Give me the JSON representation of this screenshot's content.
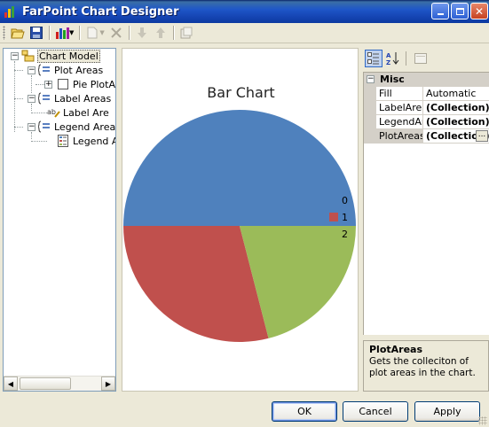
{
  "window": {
    "title": "FarPoint Chart Designer"
  },
  "toolbar": {
    "icons": [
      "open-folder-icon",
      "save-icon",
      "chart-type-icon",
      "new-document-icon",
      "delete-icon",
      "move-down-icon",
      "move-up-icon",
      "properties-icon"
    ]
  },
  "tree": {
    "root": "Chart Model",
    "plot_areas": "Plot Areas",
    "pie_plot_area": "Pie PlotAr",
    "label_areas": "Label Areas",
    "label_area": "Label Are",
    "legend_areas": "Legend Areas",
    "legend_area": "Legend A"
  },
  "chart_data": {
    "type": "pie",
    "title": "Bar Chart",
    "labels": [
      "0",
      "1",
      "2"
    ],
    "values": [
      50,
      29,
      21
    ],
    "colors": [
      "#4f81bd",
      "#c0504d",
      "#9bbb59"
    ],
    "legend_position": "right"
  },
  "property_grid": {
    "category": "Misc",
    "rows": [
      {
        "name": "Fill",
        "value": "Automatic",
        "bold": false
      },
      {
        "name": "LabelAreas",
        "value": "(Collection)",
        "bold": true
      },
      {
        "name": "LegendAreas",
        "value": "(Collection)",
        "bold": true
      },
      {
        "name": "PlotAreas",
        "value": "(Collection)",
        "bold": true
      }
    ],
    "ellipsis": "..."
  },
  "help": {
    "title": "PlotAreas",
    "description": "Gets the colleciton of plot areas in the chart."
  },
  "buttons": {
    "ok": "OK",
    "cancel": "Cancel",
    "apply": "Apply"
  }
}
